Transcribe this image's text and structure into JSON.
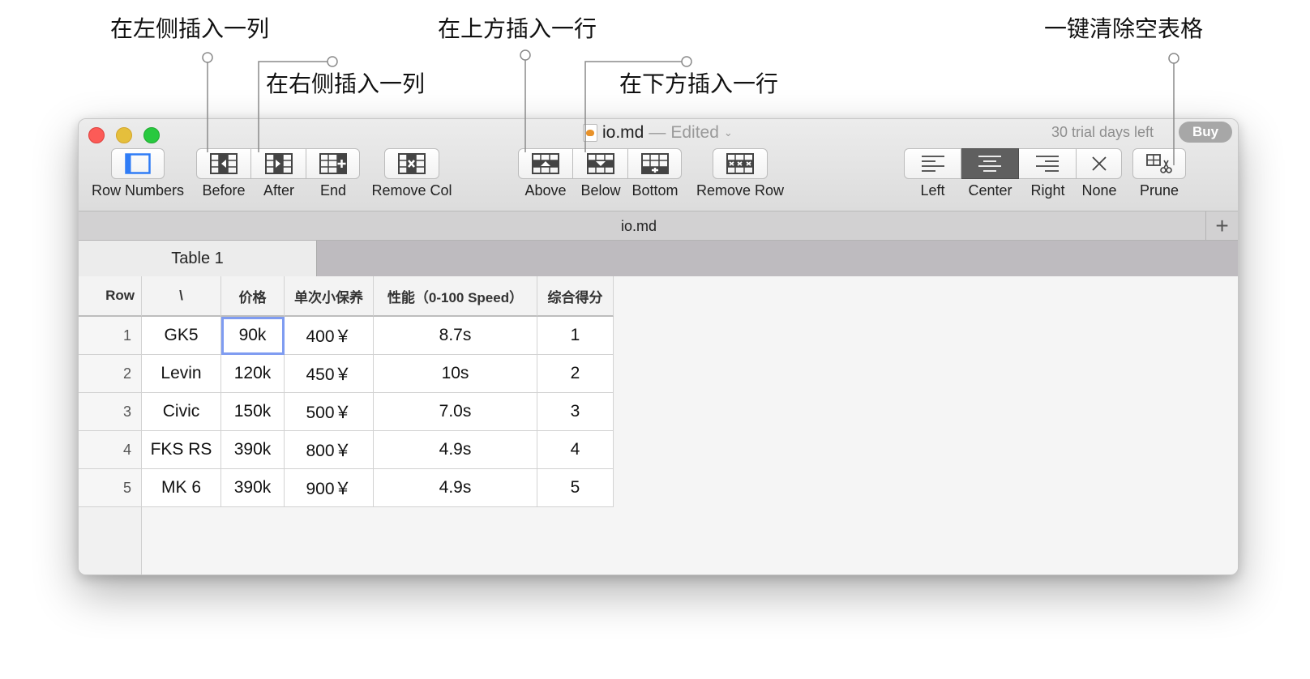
{
  "annotations": {
    "insert_col_left": "在左侧插入一列",
    "insert_col_right": "在右侧插入一列",
    "insert_row_above": "在上方插入一行",
    "insert_row_below": "在下方插入一行",
    "prune_empty": "一键清除空表格"
  },
  "window": {
    "doc_name": "io.md",
    "separator": "—",
    "edited": "Edited",
    "trial_text": "30 trial days left",
    "buy_label": "Buy"
  },
  "toolbar": {
    "row_numbers": "Row Numbers",
    "before": "Before",
    "after": "After",
    "end": "End",
    "remove_col": "Remove Col",
    "above": "Above",
    "below": "Below",
    "bottom": "Bottom",
    "remove_row": "Remove Row",
    "left": "Left",
    "center": "Center",
    "right": "Right",
    "none": "None",
    "prune": "Prune",
    "active_alignment": "Center"
  },
  "file_tab": {
    "label": "io.md",
    "plus": "+"
  },
  "sheet_tab": {
    "label": "Table 1"
  },
  "table": {
    "row_header": "Row",
    "columns": [
      "\\",
      "价格",
      "单次小保养",
      "性能（0-100 Speed）",
      "综合得分"
    ],
    "rows": [
      {
        "num": "1",
        "cells": [
          "GK5",
          "90k",
          "400￥",
          "8.7s",
          "1"
        ]
      },
      {
        "num": "2",
        "cells": [
          "Levin",
          "120k",
          "450￥",
          "10s",
          "2"
        ]
      },
      {
        "num": "3",
        "cells": [
          "Civic",
          "150k",
          "500￥",
          "7.0s",
          "3"
        ]
      },
      {
        "num": "4",
        "cells": [
          "FKS RS",
          "390k",
          "800￥",
          "4.9s",
          "4"
        ]
      },
      {
        "num": "5",
        "cells": [
          "MK 6",
          "390k",
          "900￥",
          "4.9s",
          "5"
        ]
      }
    ],
    "selected_cell": "90k"
  },
  "colors": {
    "selection": "#7f9cf1",
    "row_numbers_icon": "#2f7cf6",
    "active_button": "#5f5f5f"
  }
}
